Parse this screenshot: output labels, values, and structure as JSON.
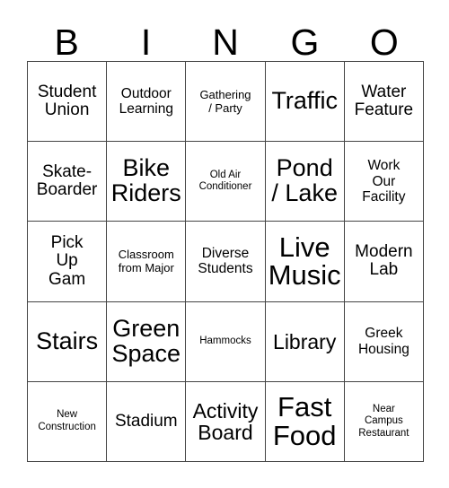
{
  "card": {
    "title": "BINGO",
    "header_letters": [
      "B",
      "I",
      "N",
      "G",
      "O"
    ],
    "rows": 5,
    "columns": 5,
    "border_color": "#444444",
    "text_color": "#000000",
    "background_color": "#ffffff"
  },
  "cells": [
    {
      "text": "Student\nUnion",
      "size": "l"
    },
    {
      "text": "Outdoor\nLearning",
      "size": "m"
    },
    {
      "text": "Gathering\n/ Party",
      "size": "s"
    },
    {
      "text": "Traffic",
      "size": "xxl"
    },
    {
      "text": "Water\nFeature",
      "size": "l"
    },
    {
      "text": "Skate-\nBoarder",
      "size": "l"
    },
    {
      "text": "Bike\nRiders",
      "size": "xxl"
    },
    {
      "text": "Old Air\nConditioner",
      "size": "xs"
    },
    {
      "text": "Pond\n/ Lake",
      "size": "xxl"
    },
    {
      "text": "Work\nOur\nFacility",
      "size": "m"
    },
    {
      "text": "Pick\nUp\nGam",
      "size": "l"
    },
    {
      "text": "Classroom\nfrom Major",
      "size": "s"
    },
    {
      "text": "Diverse\nStudents",
      "size": "m"
    },
    {
      "text": "Live\nMusic",
      "size": "hg"
    },
    {
      "text": "Modern\nLab",
      "size": "l"
    },
    {
      "text": "Stairs",
      "size": "xxl"
    },
    {
      "text": "Green\nSpace",
      "size": "xxl"
    },
    {
      "text": "Hammocks",
      "size": "xs"
    },
    {
      "text": "Library",
      "size": "xl"
    },
    {
      "text": "Greek\nHousing",
      "size": "m"
    },
    {
      "text": "New\nConstruction",
      "size": "xs"
    },
    {
      "text": "Stadium",
      "size": "l"
    },
    {
      "text": "Activity\nBoard",
      "size": "xl"
    },
    {
      "text": "Fast\nFood",
      "size": "hg"
    },
    {
      "text": "Near\nCampus\nRestaurant",
      "size": "xs"
    }
  ]
}
